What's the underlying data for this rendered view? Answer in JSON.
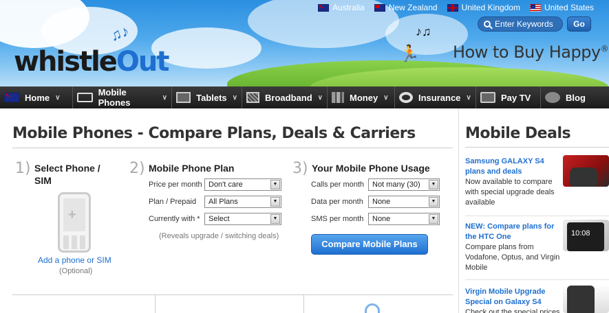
{
  "countries": [
    {
      "name": "Australia",
      "flag": "au-flag-icon"
    },
    {
      "name": "New Zealand",
      "flag": "nz-flag-icon"
    },
    {
      "name": "United Kingdom",
      "flag": "uk-flag-icon"
    },
    {
      "name": "United States",
      "flag": "us-flag-icon"
    }
  ],
  "brand": {
    "logo_part1": "whistle",
    "logo_part2": "Out",
    "tagline": "How to Buy Happy",
    "tagline_mark": "®"
  },
  "search": {
    "placeholder": "Enter Keywords",
    "go_label": "Go"
  },
  "nav": [
    {
      "label": "Home",
      "icon": "au-flag-icon"
    },
    {
      "label": "Mobile Phones",
      "icon": "phone-icon"
    },
    {
      "label": "Tablets",
      "icon": "tablet-icon"
    },
    {
      "label": "Broadband",
      "icon": "broadband-icon"
    },
    {
      "label": "Money",
      "icon": "money-icon"
    },
    {
      "label": "Insurance",
      "icon": "insurance-icon"
    },
    {
      "label": "Pay TV",
      "icon": "tv-icon"
    },
    {
      "label": "Blog",
      "icon": "blog-icon"
    }
  ],
  "main": {
    "title": "Mobile Phones - Compare Plans, Deals & Carriers",
    "step1": {
      "num": "1)",
      "title": "Select Phone / SIM",
      "add_link": "Add a phone or SIM",
      "optional": "(Optional)"
    },
    "step2": {
      "num": "2)",
      "title": "Mobile Phone Plan",
      "rows": [
        {
          "label": "Price per month",
          "value": "Don't care"
        },
        {
          "label": "Plan / Prepaid",
          "value": "All Plans"
        },
        {
          "label": "Currently with *",
          "value": "Select"
        }
      ],
      "note": "(Reveals upgrade / switching deals)"
    },
    "step3": {
      "num": "3)",
      "title": "Your Mobile Phone Usage",
      "rows": [
        {
          "label": "Calls per month",
          "value": "Not many (30)"
        },
        {
          "label": "Data per month",
          "value": "None"
        },
        {
          "label": "SMS per month",
          "value": "None"
        }
      ],
      "button": "Compare Mobile Plans"
    }
  },
  "sidebar": {
    "title": "Mobile Deals",
    "deals": [
      {
        "link": "Samsung GALAXY S4 plans and deals",
        "desc": "Now available to compare with special upgrade deals available"
      },
      {
        "link": "NEW: Compare plans for the HTC One",
        "desc": "Compare plans from Vodafone, Optus, and Virgin Mobile"
      },
      {
        "link": "Virgin Mobile Upgrade Special on Galaxy S4",
        "desc": "Check out the special prices"
      }
    ],
    "deal2_time": "10:08"
  }
}
